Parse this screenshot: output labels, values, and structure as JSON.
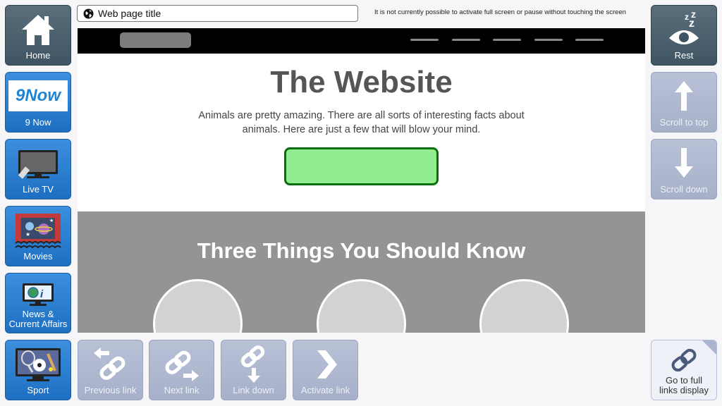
{
  "left_menu": {
    "home": "Home",
    "nine_now": "9 Now",
    "nine_now_logo_text": "9Now",
    "live_tv": "Live TV",
    "movies": "Movies",
    "news_line1": "News &",
    "news_line2": "Current Affairs",
    "sport": "Sport"
  },
  "right_menu": {
    "rest": "Rest",
    "scroll_top": "Scroll to top",
    "scroll_down": "Scroll down",
    "full_links_line1": "Go to full",
    "full_links_line2": "links display"
  },
  "bottom_menu": {
    "previous_link": "Previous link",
    "next_link": "Next link",
    "link_down": "Link down",
    "activate_link": "Activate link"
  },
  "browser": {
    "page_title": "Web page title",
    "notice": "It is not currently possible to activate full screen or pause without touching the screen"
  },
  "site": {
    "title": "The Website",
    "intro": "Animals are pretty amazing.  There are all sorts of interesting facts about animals.  Here are just a few that will blow your mind.",
    "section_title": "Three Things You Should Know"
  },
  "colors": {
    "accent_blue": "#2a7fd4",
    "slate": "#4a5f6c",
    "disabled": "#aeb8ce",
    "cta_green": "#90ee90"
  }
}
